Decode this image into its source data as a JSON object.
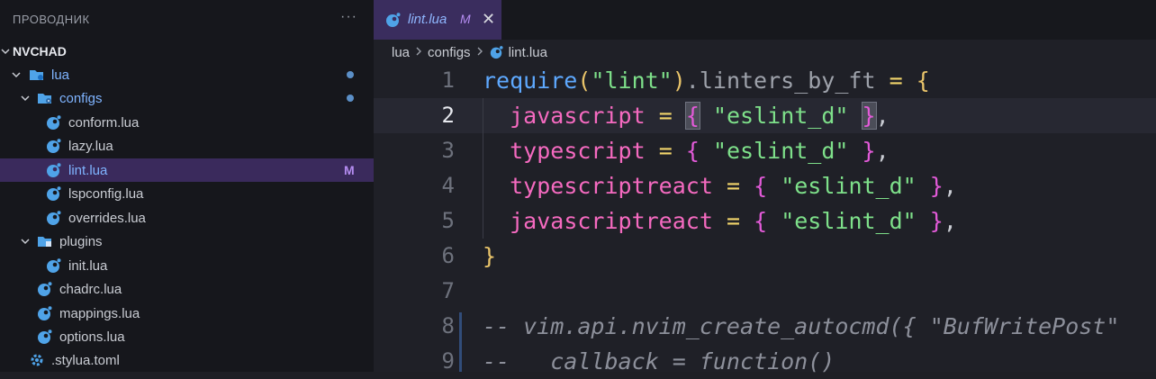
{
  "sidebar": {
    "title": "ПРОВОДНИК",
    "more": "···",
    "root": "NVCHAD",
    "items": [
      {
        "label": "lua",
        "type": "folder",
        "chev": "∨"
      },
      {
        "label": "configs",
        "type": "folder",
        "chev": "∨"
      },
      {
        "label": "conform.lua",
        "type": "file"
      },
      {
        "label": "lazy.lua",
        "type": "file"
      },
      {
        "label": "lint.lua",
        "type": "file",
        "badge": "M"
      },
      {
        "label": "lspconfig.lua",
        "type": "file"
      },
      {
        "label": "overrides.lua",
        "type": "file"
      },
      {
        "label": "plugins",
        "type": "folder",
        "chev": "∨"
      },
      {
        "label": "init.lua",
        "type": "file"
      },
      {
        "label": "chadrc.lua",
        "type": "file"
      },
      {
        "label": "mappings.lua",
        "type": "file"
      },
      {
        "label": "options.lua",
        "type": "file"
      },
      {
        "label": ".stylua.toml",
        "type": "gear"
      }
    ]
  },
  "editor": {
    "tab": {
      "name": "lint.lua",
      "status": "M",
      "close": "✕"
    },
    "breadcrumb": [
      "lua",
      "configs",
      "lint.lua"
    ],
    "lines": [
      "1",
      "2",
      "3",
      "4",
      "5",
      "6",
      "7",
      "8",
      "9"
    ]
  },
  "colors": {
    "accent": "#3a2a5c",
    "folder": "#4fa3e8",
    "file": "#4fa3e8",
    "badge": "#b48cf0"
  }
}
